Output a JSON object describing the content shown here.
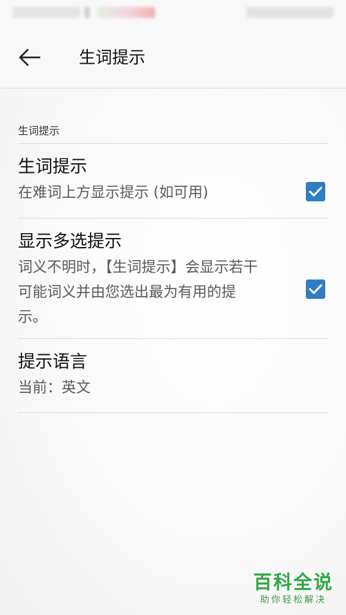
{
  "app_bar": {
    "title": "生词提示"
  },
  "section": {
    "header": "生词提示"
  },
  "preferences": [
    {
      "title": "生词提示",
      "summary": "在难词上方显示提示 (如可用)",
      "checked": true
    },
    {
      "title": "显示多选提示",
      "summary": "词义不明时，【生词提示】会显示若干可能词义并由您选出最为有用的提示。",
      "checked": true
    },
    {
      "title": "提示语言",
      "summary": "当前：英文"
    }
  ],
  "watermark": {
    "main": "百科全说",
    "sub": "助你轻松解决"
  },
  "colors": {
    "checkbox": "#2f7dc4",
    "watermark": "#2fa944"
  }
}
